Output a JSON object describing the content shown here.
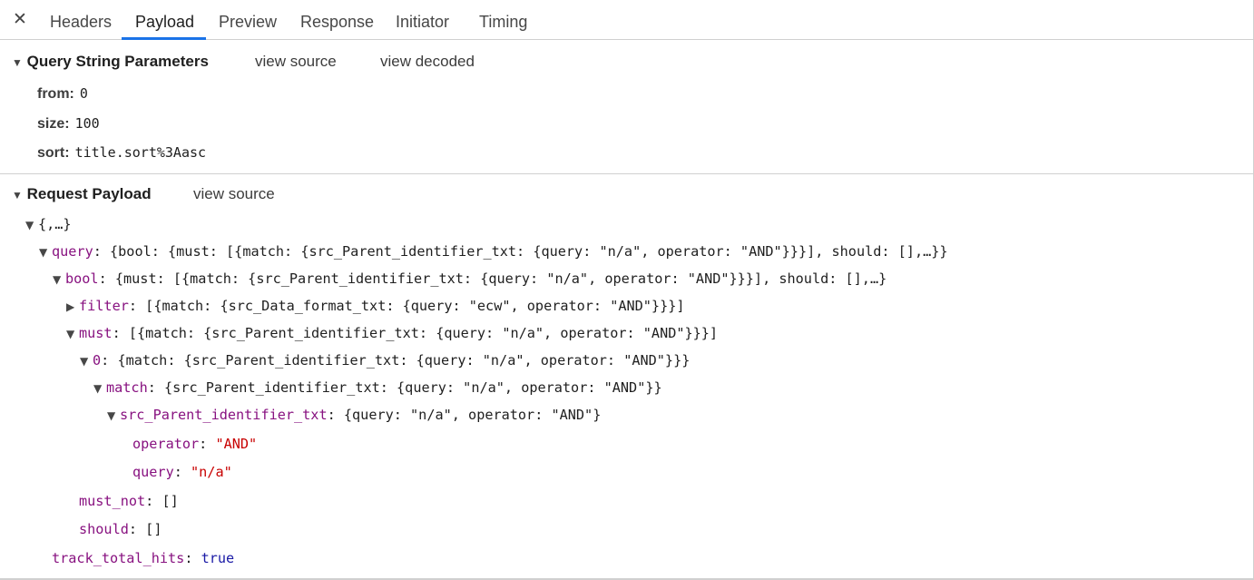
{
  "tabs": {
    "close_icon": "✕",
    "items": [
      "Headers",
      "Payload",
      "Preview",
      "Response",
      "Initiator",
      "Timing"
    ],
    "active": "Payload"
  },
  "query_section": {
    "title": "Query String Parameters",
    "view_source": "view source",
    "view_decoded": "view decoded",
    "params": [
      {
        "key": "from:",
        "value": "0"
      },
      {
        "key": "size:",
        "value": "100"
      },
      {
        "key": "sort:",
        "value": "title.sort%3Aasc"
      }
    ]
  },
  "payload_section": {
    "title": "Request Payload",
    "view_source": "view source",
    "root": "{,…}",
    "query": {
      "key": "query",
      "preview": "{bool: {must: [{match: {src_Parent_identifier_txt: {query: \"n/a\", operator: \"AND\"}}}], should: [],…}}"
    },
    "bool": {
      "key": "bool",
      "preview": "{must: [{match: {src_Parent_identifier_txt: {query: \"n/a\", operator: \"AND\"}}}], should: [],…}"
    },
    "filter": {
      "key": "filter",
      "preview": "[{match: {src_Data_format_txt: {query: \"ecw\", operator: \"AND\"}}}]"
    },
    "must": {
      "key": "must",
      "preview": "[{match: {src_Parent_identifier_txt: {query: \"n/a\", operator: \"AND\"}}}]"
    },
    "must_0": {
      "key": "0",
      "preview": "{match: {src_Parent_identifier_txt: {query: \"n/a\", operator: \"AND\"}}}"
    },
    "match": {
      "key": "match",
      "preview": "{src_Parent_identifier_txt: {query: \"n/a\", operator: \"AND\"}}"
    },
    "src": {
      "key": "src_Parent_identifier_txt",
      "preview": "{query: \"n/a\", operator: \"AND\"}"
    },
    "operator": {
      "key": "operator",
      "value": "\"AND\""
    },
    "query_val": {
      "key": "query",
      "value": "\"n/a\""
    },
    "must_not": {
      "key": "must_not",
      "value": "[]"
    },
    "should": {
      "key": "should",
      "value": "[]"
    },
    "track_total_hits": {
      "key": "track_total_hits",
      "value": "true"
    }
  }
}
